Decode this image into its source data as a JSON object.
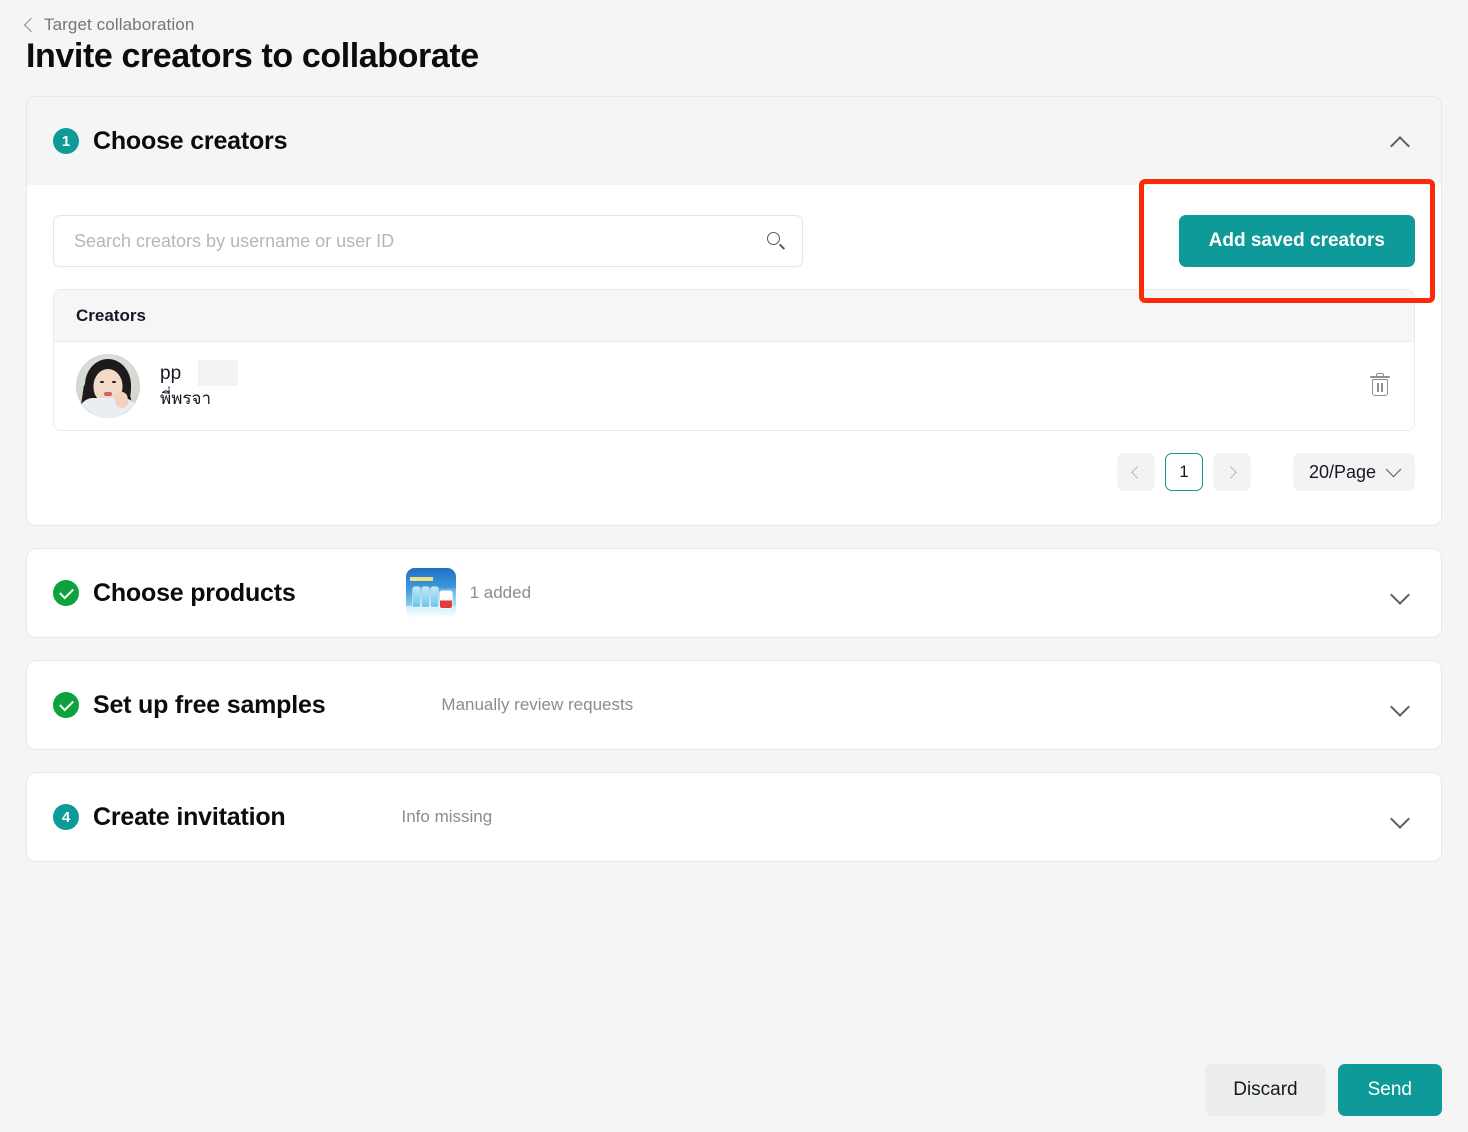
{
  "breadcrumb": {
    "back_icon": "chevron-left-icon",
    "label": "Target collaboration"
  },
  "page_title": "Invite creators to collaborate",
  "colors": {
    "accent_teal": "#0e9a98",
    "success_green": "#0ea33a",
    "annotation_red": "#fc2a07",
    "page_background": "#f5f5f5",
    "card_background": "#ffffff"
  },
  "sections": [
    {
      "id": "choose-creators",
      "step": "1",
      "title": "Choose creators",
      "state": "active",
      "summary": "",
      "expanded": true,
      "collapse_icon": "chevron-up-icon"
    },
    {
      "id": "choose-products",
      "step": "2",
      "title": "Choose products",
      "state": "done",
      "summary": "1 added",
      "expanded": false,
      "collapse_icon": "chevron-down-icon",
      "thumbnail": "product-thumbnail"
    },
    {
      "id": "set-up-free-samples",
      "step": "3",
      "title": "Set up free samples",
      "state": "done",
      "summary": "Manually review requests",
      "expanded": false,
      "collapse_icon": "chevron-down-icon"
    },
    {
      "id": "create-invitation",
      "step": "4",
      "title": "Create invitation",
      "state": "active",
      "summary": "Info missing",
      "expanded": false,
      "collapse_icon": "chevron-down-icon"
    }
  ],
  "creators_panel": {
    "search": {
      "placeholder": "Search creators by username or user ID",
      "value": "",
      "icon": "search-icon"
    },
    "add_saved_button": {
      "label": "Add saved creators",
      "highlighted": true
    },
    "table": {
      "columns": [
        "Creators"
      ],
      "rows": [
        {
          "avatar": "creator-avatar",
          "username": "pp",
          "username_redacted": true,
          "nickname": "พี่พรจา",
          "delete_icon": "trash-icon"
        }
      ]
    },
    "pagination": {
      "prev_icon": "chevron-left-icon",
      "current_page": "1",
      "next_icon": "chevron-right-icon",
      "page_size": "20/Page",
      "page_size_icon": "chevron-down-icon"
    }
  },
  "footer": {
    "discard_label": "Discard",
    "send_label": "Send"
  }
}
